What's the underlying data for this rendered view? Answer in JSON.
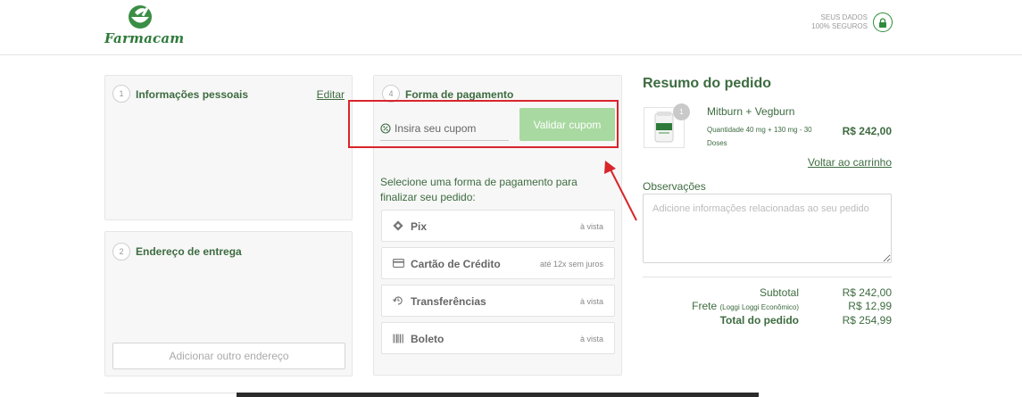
{
  "header": {
    "brand": "Farmacam",
    "secure_line1": "SEUS DADOS",
    "secure_line2": "100% SEGUROS"
  },
  "personal": {
    "step": "1",
    "title": "Informações pessoais",
    "edit_label": "Editar"
  },
  "delivery": {
    "step": "2",
    "title": "Endereço de entrega",
    "add_button": "Adicionar outro endereço"
  },
  "payment": {
    "step": "4",
    "title": "Forma de pagamento",
    "coupon_placeholder": "Insira seu cupom",
    "validate_label": "Validar cupom",
    "instructions": "Selecione uma forma de pagamento para finalizar seu pedido:",
    "options": [
      {
        "label": "Pix",
        "note": "à vista",
        "icon": "pix-icon"
      },
      {
        "label": "Cartão de Crédito",
        "note": "até 12x sem juros",
        "icon": "credit-card-icon"
      },
      {
        "label": "Transferências",
        "note": "à vista",
        "icon": "transfer-icon"
      },
      {
        "label": "Boleto",
        "note": "à vista",
        "icon": "barcode-icon"
      }
    ]
  },
  "summary": {
    "title": "Resumo do pedido",
    "product": {
      "quantity": "1",
      "name": "Mitburn + Vegburn",
      "description": "Quantidade 40 mg + 130 mg - 30 Doses",
      "price": "R$ 242,00"
    },
    "back_to_cart": "Voltar ao carrinho",
    "observations_label": "Observações",
    "observations_placeholder": "Adicione informações relacionadas ao seu pedido",
    "subtotal_label": "Subtotal",
    "subtotal_value": "R$ 242,00",
    "shipping_label": "Frete",
    "shipping_detail": "(Loggi Loggi Econômico)",
    "shipping_value": "R$ 12,99",
    "total_label": "Total do pedido",
    "total_value": "R$ 254,99"
  },
  "colors": {
    "brand_green": "#3d6b40",
    "button_green": "#a8d9a0",
    "highlight_red": "#d9252a"
  }
}
